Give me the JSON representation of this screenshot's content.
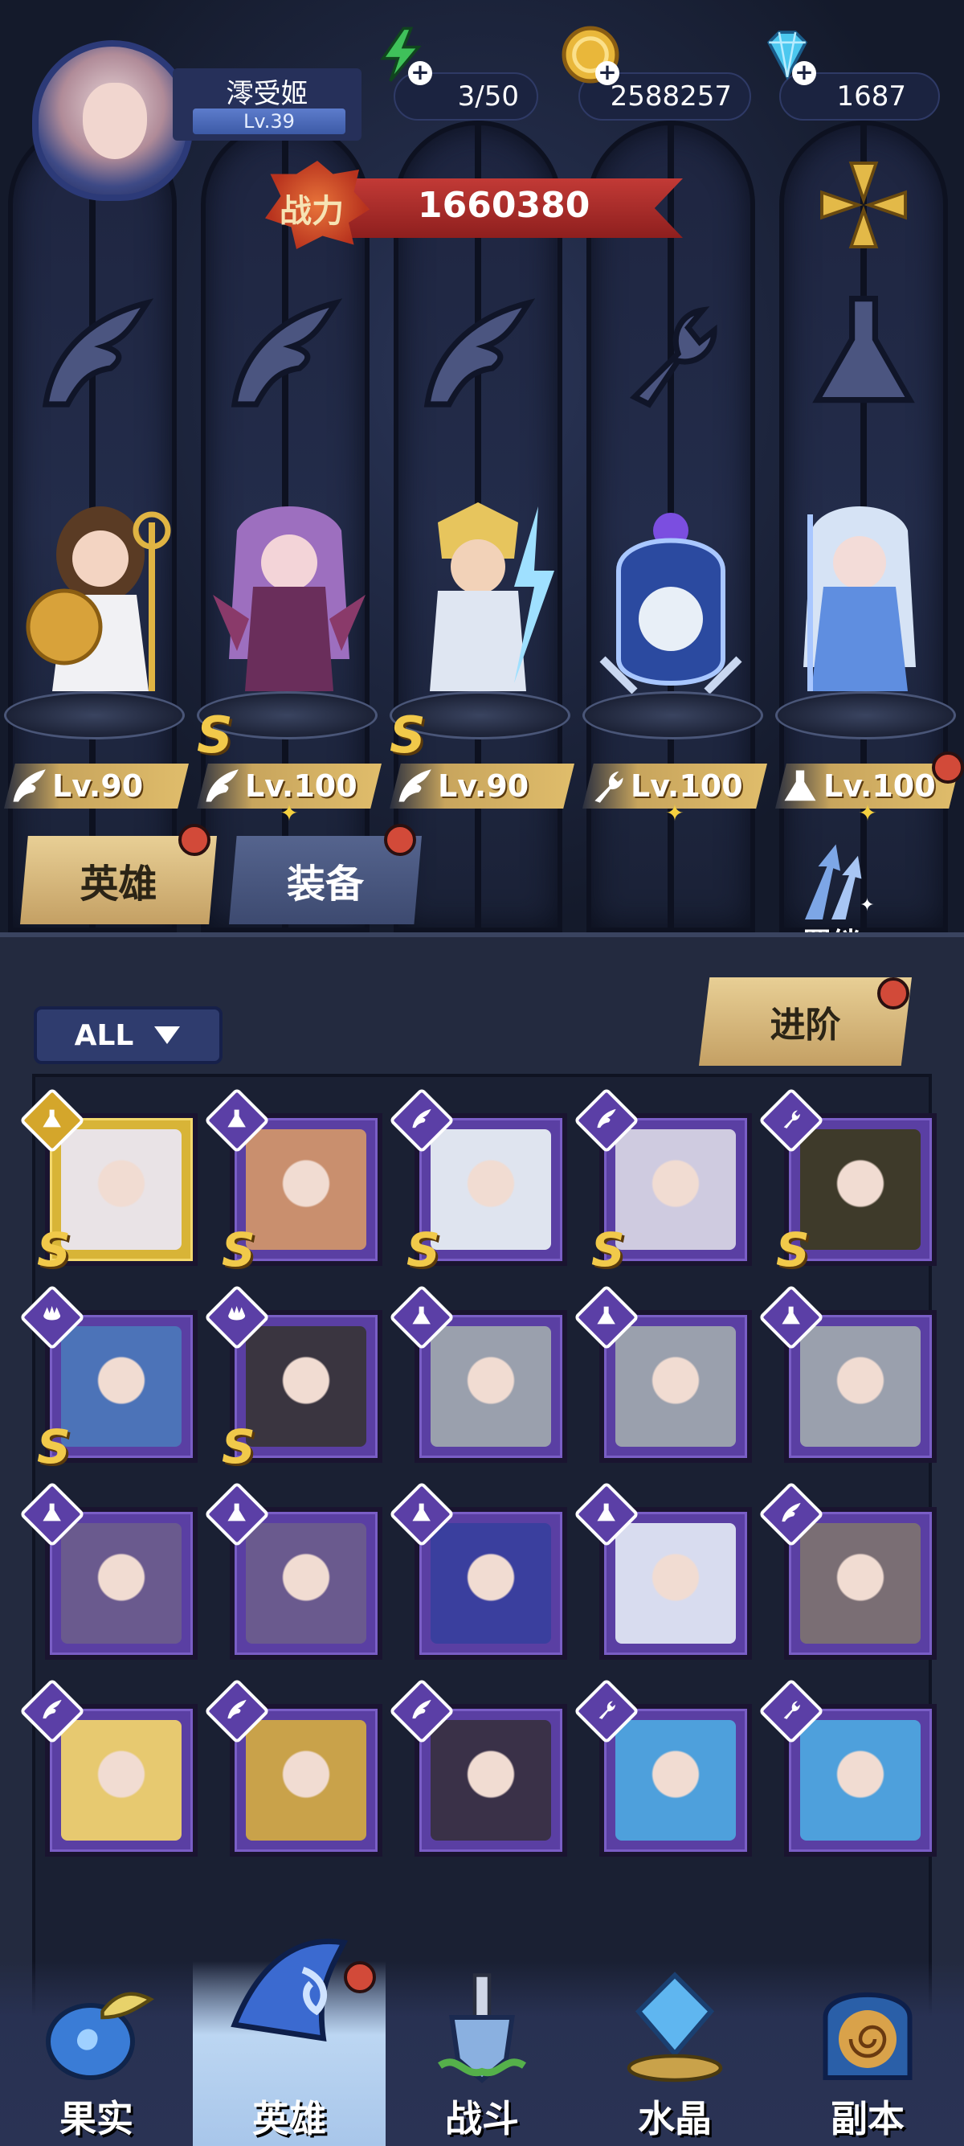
{
  "player": {
    "name": "澪受姬",
    "level": "Lv.39"
  },
  "resources": {
    "energy": "3/50",
    "gold": "2588257",
    "gems": "1687"
  },
  "power": {
    "label": "战力",
    "value": "1660380"
  },
  "lineup": [
    {
      "level": "Lv.90",
      "grade": "",
      "class_icon": "wing-icon"
    },
    {
      "level": "Lv.100",
      "grade": "S",
      "class_icon": "wing-icon"
    },
    {
      "level": "Lv.90",
      "grade": "S",
      "class_icon": "wing-icon"
    },
    {
      "level": "Lv.100",
      "grade": "",
      "class_icon": "wrench-icon"
    },
    {
      "level": "Lv.100",
      "grade": "",
      "class_icon": "flask-icon"
    }
  ],
  "tabs": {
    "heroes": "英雄",
    "equipment": "装备",
    "bond": "羁绊"
  },
  "filter": {
    "label": "ALL"
  },
  "advance_button": "进阶",
  "roster": [
    {
      "class_icon": "flask-icon",
      "grade": "S",
      "frame": "gold"
    },
    {
      "class_icon": "flask-icon",
      "grade": "S",
      "frame": "purple"
    },
    {
      "class_icon": "wing-icon",
      "grade": "S",
      "frame": "purple"
    },
    {
      "class_icon": "wing-icon",
      "grade": "S",
      "frame": "purple"
    },
    {
      "class_icon": "wrench-icon",
      "grade": "S",
      "frame": "purple"
    },
    {
      "class_icon": "beast-icon",
      "grade": "S",
      "frame": "purple"
    },
    {
      "class_icon": "beast-icon",
      "grade": "S",
      "frame": "purple"
    },
    {
      "class_icon": "flask-icon",
      "grade": "",
      "frame": "purple"
    },
    {
      "class_icon": "flask-icon",
      "grade": "",
      "frame": "purple"
    },
    {
      "class_icon": "flask-icon",
      "grade": "",
      "frame": "purple"
    },
    {
      "class_icon": "flask-icon",
      "grade": "",
      "frame": "purple"
    },
    {
      "class_icon": "flask-icon",
      "grade": "",
      "frame": "purple"
    },
    {
      "class_icon": "flask-icon",
      "grade": "",
      "frame": "purple"
    },
    {
      "class_icon": "flask-icon",
      "grade": "",
      "frame": "purple"
    },
    {
      "class_icon": "wing-icon",
      "grade": "",
      "frame": "purple"
    },
    {
      "class_icon": "wing-icon",
      "grade": "",
      "frame": "purple"
    },
    {
      "class_icon": "wing-icon",
      "grade": "",
      "frame": "purple"
    },
    {
      "class_icon": "wing-icon",
      "grade": "",
      "frame": "purple"
    },
    {
      "class_icon": "wrench-icon",
      "grade": "",
      "frame": "purple"
    },
    {
      "class_icon": "wrench-icon",
      "grade": "",
      "frame": "purple"
    }
  ],
  "nav": {
    "fruit": "果实",
    "heroes": "英雄",
    "battle": "战斗",
    "crystal": "水晶",
    "dungeon": "副本"
  },
  "colors": {
    "background": "#141a2b",
    "card_purple": "#5a3fa3",
    "card_gold": "#d8b437",
    "grade_gold": "#f1c94a",
    "notification_red": "#d24a39",
    "nav_active": "#bcd6f2"
  }
}
